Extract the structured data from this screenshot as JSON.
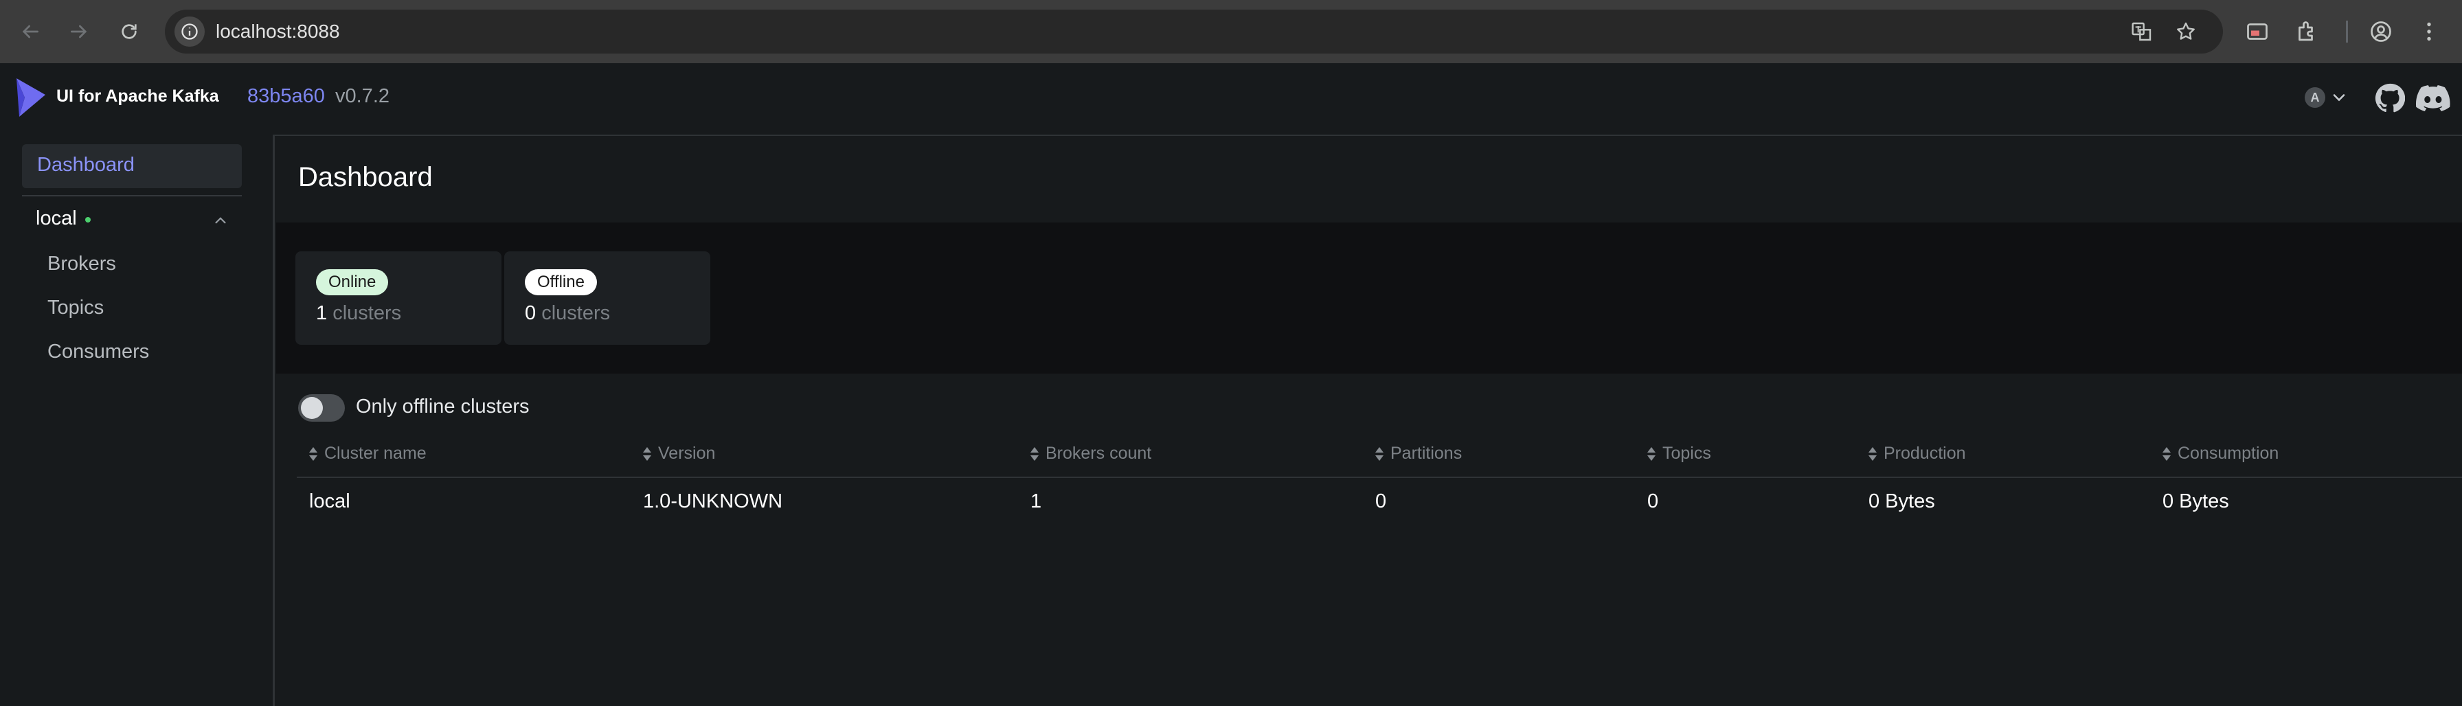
{
  "browser": {
    "url": "localhost:8088",
    "icons": [
      "back-icon",
      "forward-icon",
      "reload-icon",
      "site-info-icon",
      "translate-icon",
      "bookmark-star-icon",
      "cast-icon",
      "extensions-icon",
      "profile-icon",
      "menu-icon"
    ]
  },
  "header": {
    "app_name": "UI for Apache Kafka",
    "commit": "83b5a60",
    "version": "v0.7.2",
    "user_initial": "A"
  },
  "sidebar": {
    "dashboard": "Dashboard",
    "cluster": {
      "name": "local",
      "status_color": "#4ccf6e",
      "items": [
        "Brokers",
        "Topics",
        "Consumers"
      ]
    }
  },
  "main": {
    "title": "Dashboard",
    "stats": {
      "online": {
        "label": "Online",
        "count": "1",
        "unit": "clusters"
      },
      "offline": {
        "label": "Offline",
        "count": "0",
        "unit": "clusters"
      }
    },
    "toggle": {
      "label": "Only offline clusters",
      "checked": false
    },
    "table": {
      "columns": [
        "Cluster name",
        "Version",
        "Brokers count",
        "Partitions",
        "Topics",
        "Production",
        "Consumption"
      ],
      "rows": [
        [
          "local",
          "1.0-UNKNOWN",
          "1",
          "0",
          "0",
          "0 Bytes",
          "0 Bytes"
        ]
      ]
    }
  },
  "colors": {
    "accent": "#7d86f0",
    "background": "#171a1c",
    "online_pill": "#d5f5dc"
  }
}
